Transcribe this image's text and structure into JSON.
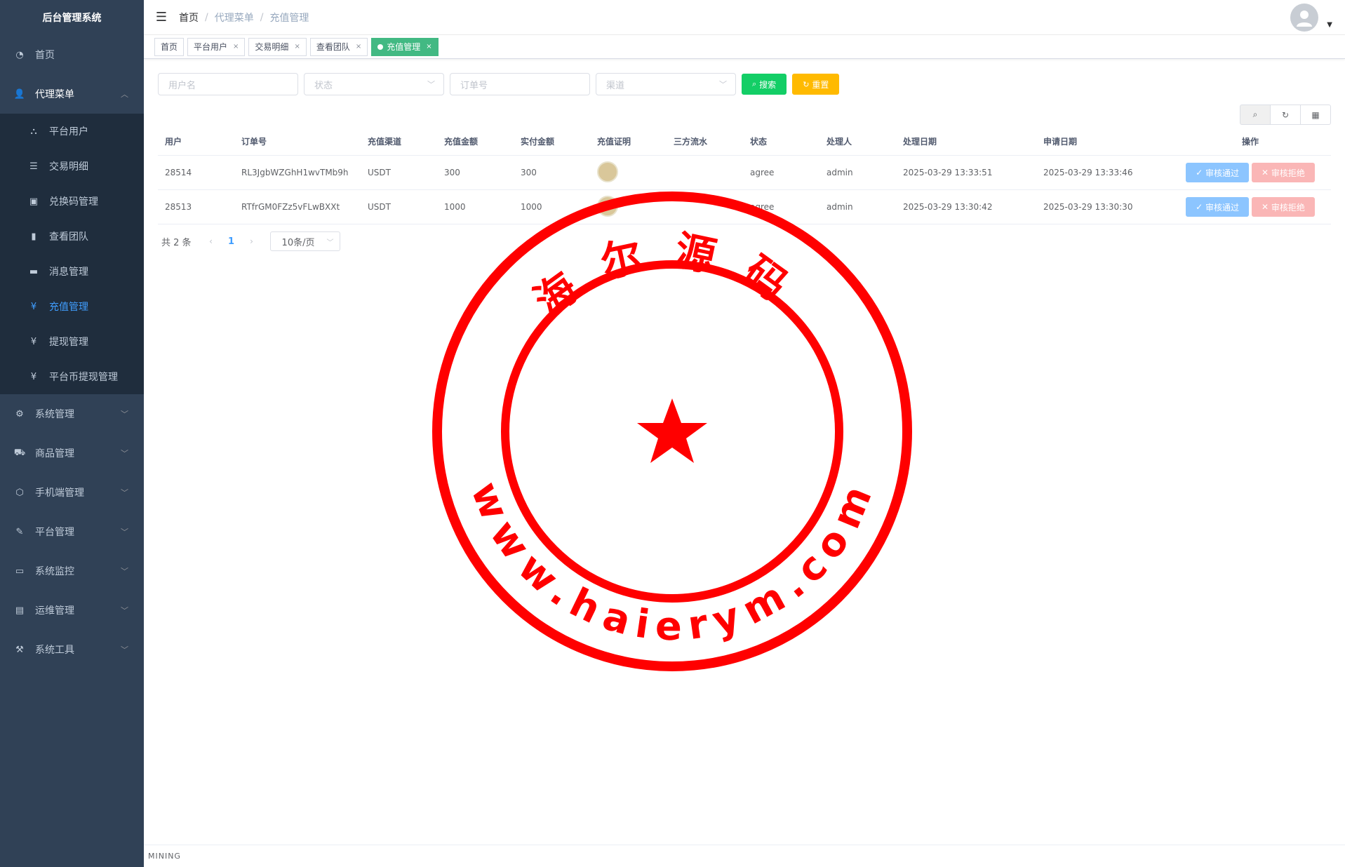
{
  "app": {
    "title": "后台管理系统"
  },
  "sidebar": {
    "items": [
      {
        "label": "首页",
        "icon": "dashboard-icon"
      },
      {
        "label": "代理菜单",
        "icon": "user-icon",
        "open": true,
        "children": [
          {
            "label": "平台用户",
            "icon": "tree-icon"
          },
          {
            "label": "交易明细",
            "icon": "list-icon"
          },
          {
            "label": "兑换码管理",
            "icon": "ticket-icon"
          },
          {
            "label": "查看团队",
            "icon": "chart-icon"
          },
          {
            "label": "消息管理",
            "icon": "message-icon"
          },
          {
            "label": "充值管理",
            "icon": "yen-icon",
            "active": true
          },
          {
            "label": "提现管理",
            "icon": "yen-icon"
          },
          {
            "label": "平台币提现管理",
            "icon": "yen-icon"
          }
        ]
      },
      {
        "label": "系统管理",
        "icon": "gear-icon"
      },
      {
        "label": "商品管理",
        "icon": "cart-icon"
      },
      {
        "label": "手机端管理",
        "icon": "cube-icon"
      },
      {
        "label": "平台管理",
        "icon": "tools-icon"
      },
      {
        "label": "系统监控",
        "icon": "monitor-icon"
      },
      {
        "label": "运维管理",
        "icon": "server-icon"
      },
      {
        "label": "系统工具",
        "icon": "wrench-icon"
      }
    ]
  },
  "breadcrumb": [
    "首页",
    "代理菜单",
    "充值管理"
  ],
  "tags": [
    {
      "label": "首页",
      "closable": false
    },
    {
      "label": "平台用户",
      "closable": true
    },
    {
      "label": "交易明细",
      "closable": true
    },
    {
      "label": "查看团队",
      "closable": true
    },
    {
      "label": "充值管理",
      "closable": true,
      "active": true
    }
  ],
  "search": {
    "username_placeholder": "用户名",
    "status_placeholder": "状态",
    "order_placeholder": "订单号",
    "channel_placeholder": "渠道",
    "search_label": "搜索",
    "reset_label": "重置"
  },
  "table": {
    "headers": [
      "用户",
      "订单号",
      "充值渠道",
      "充值金额",
      "实付金额",
      "充值证明",
      "三方流水",
      "状态",
      "处理人",
      "处理日期",
      "申请日期",
      "操作"
    ],
    "rows": [
      {
        "user": "28514",
        "order": "RL3JgbWZGhH1wvTMb9h",
        "channel": "USDT",
        "amount": "300",
        "paid": "300",
        "flow": "",
        "status": "agree",
        "handler": "admin",
        "handled_at": "2025-03-29 13:33:51",
        "applied_at": "2025-03-29 13:33:46"
      },
      {
        "user": "28513",
        "order": "RTfrGM0FZz5vFLwBXXt",
        "channel": "USDT",
        "amount": "1000",
        "paid": "1000",
        "flow": "",
        "status": "agree",
        "handler": "admin",
        "handled_at": "2025-03-29 13:30:42",
        "applied_at": "2025-03-29 13:30:30"
      }
    ],
    "approve_label": "审核通过",
    "reject_label": "审核拒绝"
  },
  "pager": {
    "total": "共 2 条",
    "page": "1",
    "size": "10条/页"
  },
  "footer": {
    "text": "MINING"
  },
  "watermark": {
    "text_top": "海尔源码",
    "text_bottom": "www.haierym.com",
    "color": "#ff0000"
  },
  "colors": {
    "sidebar": "#304156",
    "active": "#409eff",
    "tag_active": "#42b983",
    "search": "#13ce66",
    "reset": "#ffba00"
  }
}
